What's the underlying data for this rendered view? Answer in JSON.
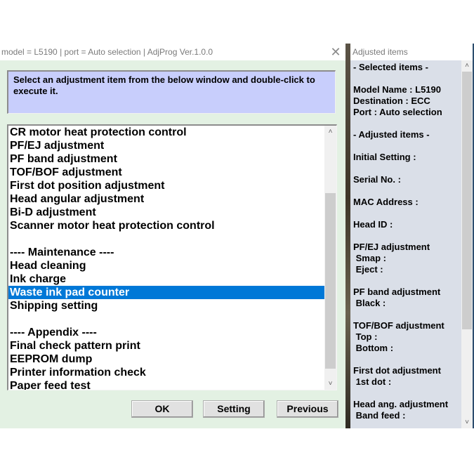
{
  "window": {
    "title": "model = L5190 | port = Auto selection | AdjProg Ver.1.0.0",
    "close_icon": "close-x-icon"
  },
  "instruction": "Select an adjustment item from the below window and double-click to execute it.",
  "list": {
    "items": [
      "CR motor heat protection control",
      "PF/EJ adjustment",
      "PF band adjustment",
      "TOF/BOF adjustment",
      "First dot position adjustment",
      "Head angular adjustment",
      "Bi-D adjustment",
      "Scanner motor heat protection control",
      "",
      "---- Maintenance ----",
      "Head cleaning",
      "Ink charge",
      "Waste ink pad counter",
      "Shipping setting",
      "",
      "---- Appendix ----",
      "Final check pattern print",
      "EEPROM dump",
      "Printer information check",
      "Paper feed test"
    ],
    "selected_index": 12,
    "scroll_up_icon": "chevron-up-icon",
    "scroll_down_icon": "chevron-down-icon"
  },
  "buttons": {
    "ok": "OK",
    "setting": "Setting",
    "previous": "Previous"
  },
  "side_panel": {
    "title": "Adjusted items",
    "lines": [
      "- Selected items -",
      "",
      "Model Name : L5190",
      "Destination : ECC",
      "Port : Auto selection",
      "",
      "- Adjusted items -",
      "",
      "Initial Setting :",
      "",
      "Serial No. :",
      "",
      "MAC Address :",
      "",
      "Head ID :",
      "",
      "PF/EJ adjustment",
      " Smap :",
      " Eject :",
      "",
      "PF band adjustment",
      " Black :",
      "",
      "TOF/BOF adjustment",
      " Top :",
      " Bottom :",
      "",
      "First dot adjustment",
      " 1st dot :",
      "",
      "Head ang. adjustment",
      " Band feed :"
    ]
  },
  "colors": {
    "selection": "#0078d7",
    "instruction_bg": "#c8cefc",
    "dialog_bg": "#e3f1e3",
    "side_bg": "#dadfe8"
  }
}
